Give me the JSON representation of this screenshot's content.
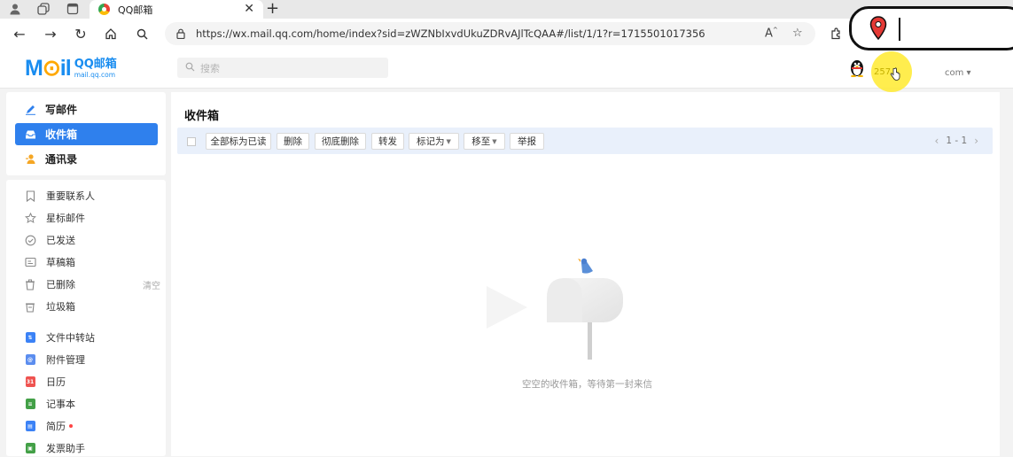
{
  "browser": {
    "tab_title": "QQ邮箱",
    "url": "https://wx.mail.qq.com/home/index?sid=zWZNbIxvdUkuZDRvAJlTcQAA#/list/1/1?r=1715501017356",
    "icons": [
      "profile-icon",
      "workspaces-icon",
      "tab-actions-icon",
      "back-icon",
      "forward-icon",
      "refresh-icon",
      "home-icon",
      "search-icon",
      "lock-icon",
      "read-aloud-icon",
      "favorite-icon",
      "extensions-icon"
    ]
  },
  "header": {
    "logo_main": "M",
    "logo_o": "⊙",
    "logo_tail": "il",
    "logo_cn": "QQ邮箱",
    "logo_domain": "mail.qq.com",
    "search_placeholder": "搜索",
    "account_number": "257",
    "account_domain": "com ▾"
  },
  "sidebar": {
    "primary": [
      {
        "label": "写邮件",
        "icon": "compose-icon"
      },
      {
        "label": "收件箱",
        "icon": "inbox-icon",
        "active": true
      },
      {
        "label": "通讯录",
        "icon": "contacts-icon"
      }
    ],
    "folders": [
      {
        "label": "重要联系人",
        "icon": "bookmark-icon"
      },
      {
        "label": "星标邮件",
        "icon": "star-icon"
      },
      {
        "label": "已发送",
        "icon": "sent-icon"
      },
      {
        "label": "草稿箱",
        "icon": "draft-icon"
      },
      {
        "label": "已删除",
        "icon": "trash-icon",
        "action": "清空"
      },
      {
        "label": "垃圾箱",
        "icon": "spam-icon"
      }
    ],
    "apps": [
      {
        "label": "文件中转站",
        "icon": "file-transfer-icon",
        "color": "#3b82f6"
      },
      {
        "label": "附件管理",
        "icon": "attachment-icon",
        "color": "#5b8def"
      },
      {
        "label": "日历",
        "icon": "calendar-icon",
        "color": "#ef5350",
        "glyph": "31"
      },
      {
        "label": "记事本",
        "icon": "notebook-icon",
        "color": "#43a047"
      },
      {
        "label": "简历",
        "icon": "resume-icon",
        "color": "#3b82f6",
        "badge": true
      },
      {
        "label": "发票助手",
        "icon": "invoice-icon",
        "color": "#43a047"
      }
    ]
  },
  "main": {
    "title": "收件箱",
    "toolbar": {
      "mark_all_read": "全部标为已读",
      "delete": "删除",
      "delete_permanently": "彻底删除",
      "forward": "转发",
      "mark_as": "标记为",
      "move_to": "移至",
      "report": "举报"
    },
    "pager": "1 - 1",
    "empty_message": "空空的收件箱，等待第一封来信"
  },
  "colors": {
    "accent": "#2f80ed",
    "toolbar_bg": "#e9f0fb",
    "cursor_highlight": "#ffeb3b"
  }
}
